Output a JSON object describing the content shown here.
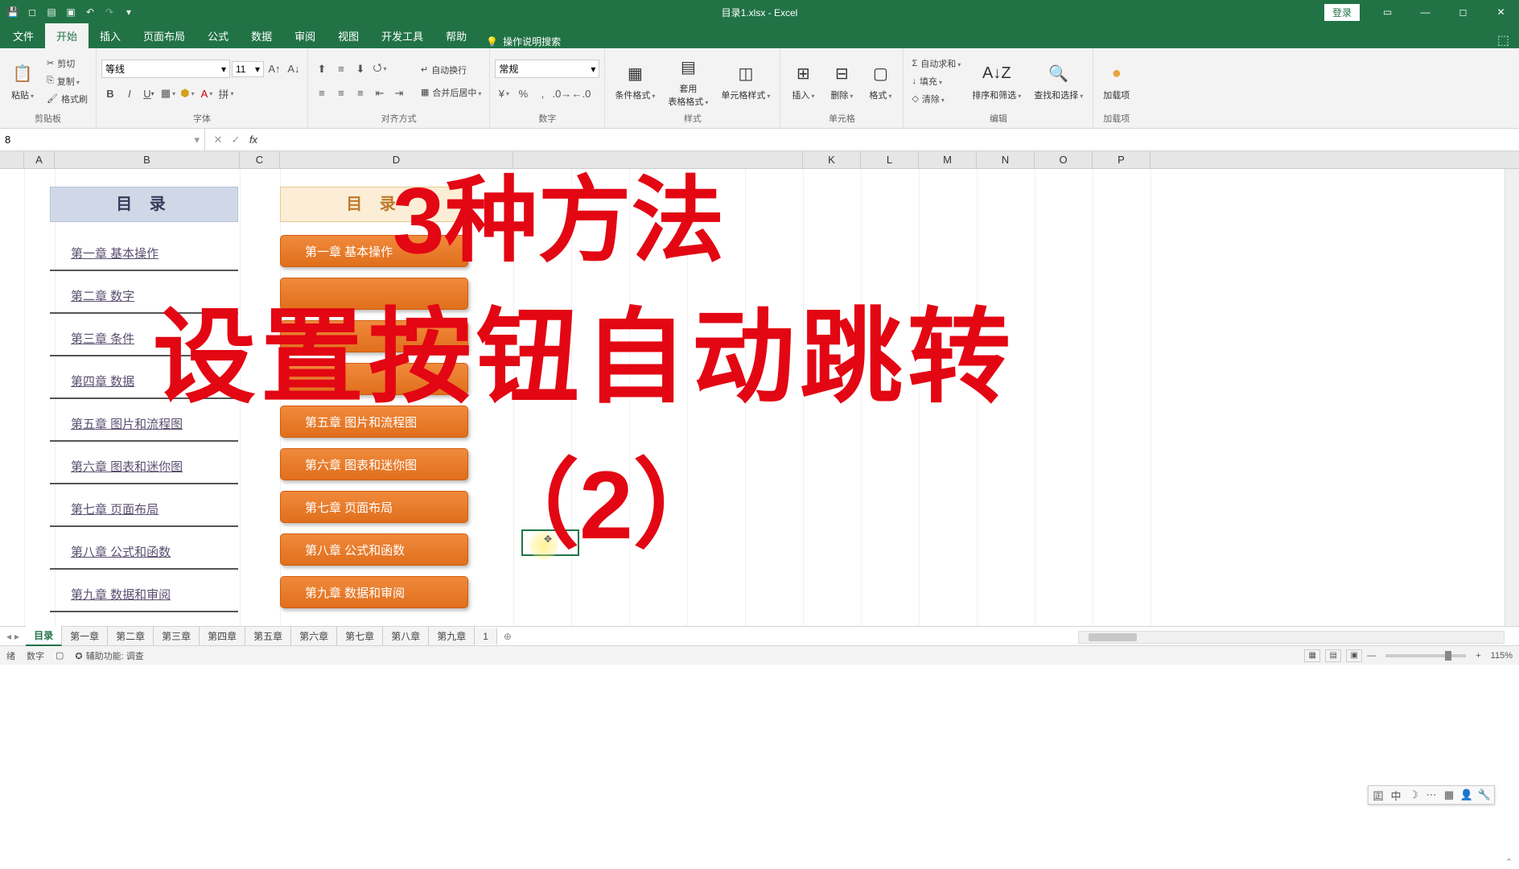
{
  "title": "目录1.xlsx - Excel",
  "login": "登录",
  "tabs": [
    "文件",
    "开始",
    "插入",
    "页面布局",
    "公式",
    "数据",
    "审阅",
    "视图",
    "开发工具",
    "帮助"
  ],
  "active_tab": "开始",
  "tell_me": "操作说明搜索",
  "clipboard": {
    "cut": "剪切",
    "copy": "复制",
    "painter": "格式刷",
    "paste": "粘贴",
    "label": "剪贴板"
  },
  "font": {
    "name": "等线",
    "size": "11",
    "label": "字体"
  },
  "align": {
    "wrap": "自动换行",
    "merge": "合并后居中",
    "label": "对齐方式"
  },
  "number": {
    "format": "常规",
    "label": "数字"
  },
  "styles": {
    "cond": "条件格式",
    "table": "套用\n表格格式",
    "cell": "单元格样式",
    "label": "样式"
  },
  "cells": {
    "insert": "插入",
    "delete": "删除",
    "format": "格式",
    "label": "单元格"
  },
  "editing": {
    "sum": "自动求和",
    "fill": "填充",
    "clear": "清除",
    "sort": "排序和筛选",
    "find": "查找和选择",
    "label": "编辑"
  },
  "addin": {
    "load": "加载项",
    "label": "加载项"
  },
  "namebox": "8",
  "columns": [
    "A",
    "B",
    "C",
    "D",
    "K",
    "L",
    "M",
    "N",
    "O",
    "P"
  ],
  "col_widths": {
    "A": 38,
    "B": 230,
    "C": 50,
    "D": 290,
    "gap": 360,
    "K": 72,
    "L": 72,
    "M": 72,
    "N": 72,
    "O": 72,
    "P": 72
  },
  "toc_b_header": "目 录",
  "toc_d_header": "目 录",
  "links": [
    "第一章   基本操作",
    "第二章   数字",
    "第三章   条件",
    "第四章   数据",
    "第五章   图片和流程图",
    "第六章   图表和迷你图",
    "第七章   页面布局",
    "第八章   公式和函数",
    "第九章   数据和审阅"
  ],
  "shapes": [
    "第一章  基本操作",
    "",
    "",
    "",
    "第五章  图片和流程图",
    "第六章  图表和迷你图",
    "第七章  页面布局",
    "第八章  公式和函数",
    "第九章  数据和审阅"
  ],
  "overlay": {
    "line1": "3种方法",
    "line2": "设置按钮自动跳转",
    "line3": "（2）"
  },
  "sheets": [
    "目录",
    "第一章",
    "第二章",
    "第三章",
    "第四章",
    "第五章",
    "第六章",
    "第七章",
    "第八章",
    "第九章",
    "1"
  ],
  "active_sheet": "目录",
  "status": {
    "ready": "绪",
    "mode": "数字",
    "access": "辅助功能: 调查",
    "zoom": "115%"
  },
  "floating_icons": [
    "囸",
    "中",
    "☽",
    "⋯",
    "▦",
    "👤",
    "🔧"
  ]
}
